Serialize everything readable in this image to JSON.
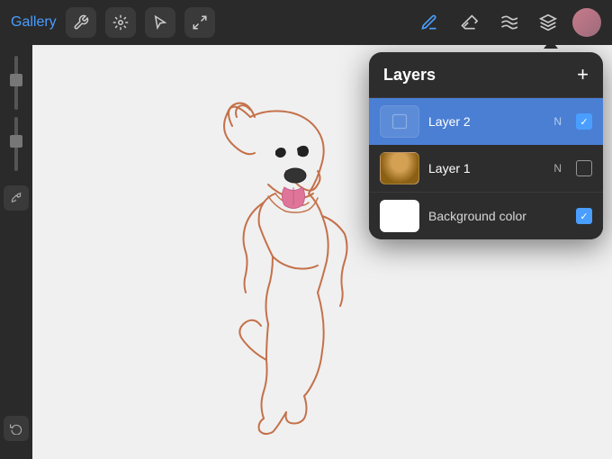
{
  "toolbar": {
    "gallery_label": "Gallery",
    "tools": [
      {
        "name": "wrench",
        "symbol": "🔧"
      },
      {
        "name": "adjust",
        "symbol": "✦"
      },
      {
        "name": "selection",
        "symbol": "S"
      },
      {
        "name": "transform",
        "symbol": "↗"
      }
    ],
    "right_tools": [
      {
        "name": "pen",
        "symbol": "✏"
      },
      {
        "name": "eraser",
        "symbol": "◈"
      },
      {
        "name": "smudge",
        "symbol": "〰"
      },
      {
        "name": "layers",
        "symbol": "⊞"
      }
    ]
  },
  "layers": {
    "title": "Layers",
    "add_button": "+",
    "items": [
      {
        "id": "layer2",
        "name": "Layer 2",
        "mode": "N",
        "active": true,
        "checked": true,
        "thumb_type": "empty"
      },
      {
        "id": "layer1",
        "name": "Layer 1",
        "mode": "N",
        "active": false,
        "checked": false,
        "thumb_type": "dog"
      }
    ],
    "background": {
      "label": "Background color",
      "checked": true
    }
  }
}
